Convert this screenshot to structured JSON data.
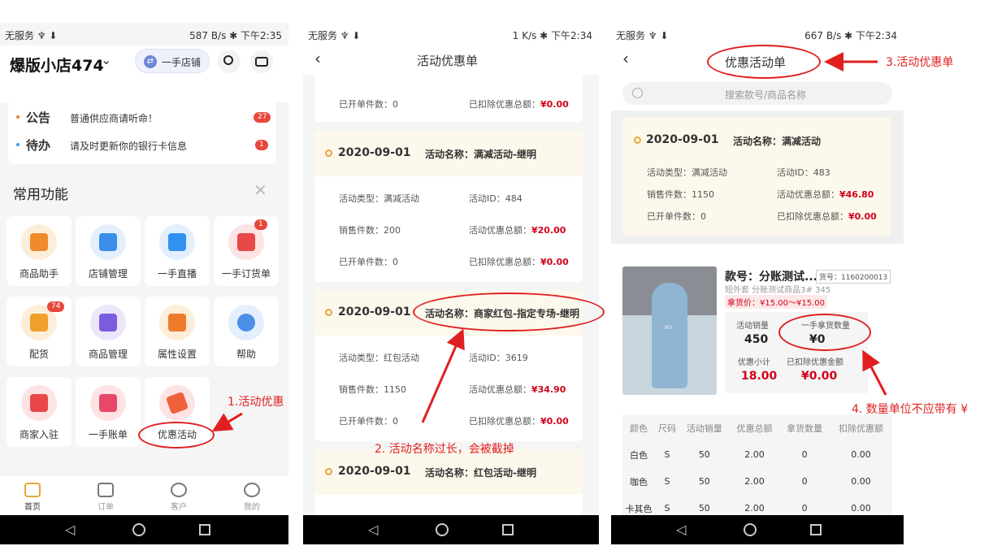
{
  "phone1": {
    "status_left": "无服务 ♆ ⬇",
    "status_right": "587 B/s ✱ 下午2:35",
    "shop_name": "爆版小店474",
    "shop_dropdown": "⌄",
    "switch_label": "一手店铺",
    "notice_title": "公告",
    "notice_text": "普通供应商请听命！",
    "notice_count": "27",
    "todo_title": "待办",
    "todo_text": "请及时更新你的银行卡信息",
    "todo_count": "1",
    "section_title": "常用功能",
    "features": [
      {
        "label": "商品助手"
      },
      {
        "label": "店铺管理"
      },
      {
        "label": "一手直播"
      },
      {
        "label": "一手订货单",
        "badge": "1"
      },
      {
        "label": "配货",
        "badge": "74"
      },
      {
        "label": "商品管理"
      },
      {
        "label": "属性设置"
      },
      {
        "label": "帮助"
      },
      {
        "label": "商家入驻"
      },
      {
        "label": "一手账单"
      },
      {
        "label": "优惠活动"
      }
    ],
    "tabs": [
      "首页",
      "订单",
      "客户",
      "我的"
    ],
    "annotation": "1.活动优惠"
  },
  "phone2": {
    "status_left": "无服务 ♆ ⬇",
    "status_right": "1 K/s ✱ 下午2:34",
    "title": "活动优惠单",
    "top_card": {
      "opened_label": "已开单件数：0",
      "deduct_label": "已扣除优惠总额：",
      "deduct_val": "¥0.00"
    },
    "cards": [
      {
        "date": "2020-09-01",
        "name": "活动名称：满减活动-继明",
        "type": "活动类型：满减活动",
        "id": "活动ID：484",
        "sales": "销售件数：200",
        "total_label": "活动优惠总额：",
        "total": "¥20.00",
        "opened": "已开单件数：0",
        "deduct_label": "已扣除优惠总额：",
        "deduct": "¥0.00"
      },
      {
        "date": "2020-09-01",
        "name": "活动名称：商家红包-指定专场-继明",
        "type": "活动类型：红包活动",
        "id": "活动ID：3619",
        "sales": "销售件数：1150",
        "total_label": "活动优惠总额：",
        "total": "¥34.90",
        "opened": "已开单件数：0",
        "deduct_label": "已扣除优惠总额：",
        "deduct": "¥0.00"
      },
      {
        "date": "2020-09-01",
        "name": "活动名称：红包活动-继明"
      }
    ],
    "annotation": "2. 活动名称过长，会被截掉"
  },
  "phone3": {
    "status_left": "无服务 ♆ ⬇",
    "status_right": "667 B/s ✱ 下午2:34",
    "title": "优惠活动单",
    "search_placeholder": "搜索款号/商品名称",
    "card": {
      "date": "2020-09-01",
      "name": "活动名称：满减活动",
      "type": "活动类型：满减活动",
      "id": "活动ID：483",
      "sales": "销售件数：1150",
      "total_label": "活动优惠总额：",
      "total": "¥46.80",
      "opened": "已开单件数：0",
      "deduct_label": "已扣除优惠总额：",
      "deduct": "¥0.00"
    },
    "product": {
      "name": "款号：分账测试...",
      "code": "货号：1160200013",
      "sub": "短外套  分账测试商品3# 345",
      "price": "拿货价：¥15.00～¥15.00",
      "image_caption": "NO.",
      "stats": [
        {
          "label": "活动销量",
          "value": "450"
        },
        {
          "label": "一手拿货数量",
          "value": "¥0"
        },
        {
          "label": "优惠小计",
          "value": "18.00"
        },
        {
          "label": "已扣除优惠金额",
          "value": "¥0.00"
        }
      ]
    },
    "table_headers": [
      "颜色",
      "尺码",
      "活动销量",
      "优惠总额",
      "拿货数量",
      "扣除优惠额"
    ],
    "table_rows": [
      [
        "白色",
        "S",
        "50",
        "2.00",
        "0",
        "0.00"
      ],
      [
        "咖色",
        "S",
        "50",
        "2.00",
        "0",
        "0.00"
      ],
      [
        "卡其色",
        "S",
        "50",
        "2.00",
        "0",
        "0.00"
      ]
    ],
    "annotation_title": "3.活动优惠单",
    "annotation_unit": "4. 数量单位不应带有 ¥"
  },
  "colors": {
    "accent": "#e02020",
    "value_red": "#d0021b",
    "header_bg": "#fdf8ec"
  }
}
